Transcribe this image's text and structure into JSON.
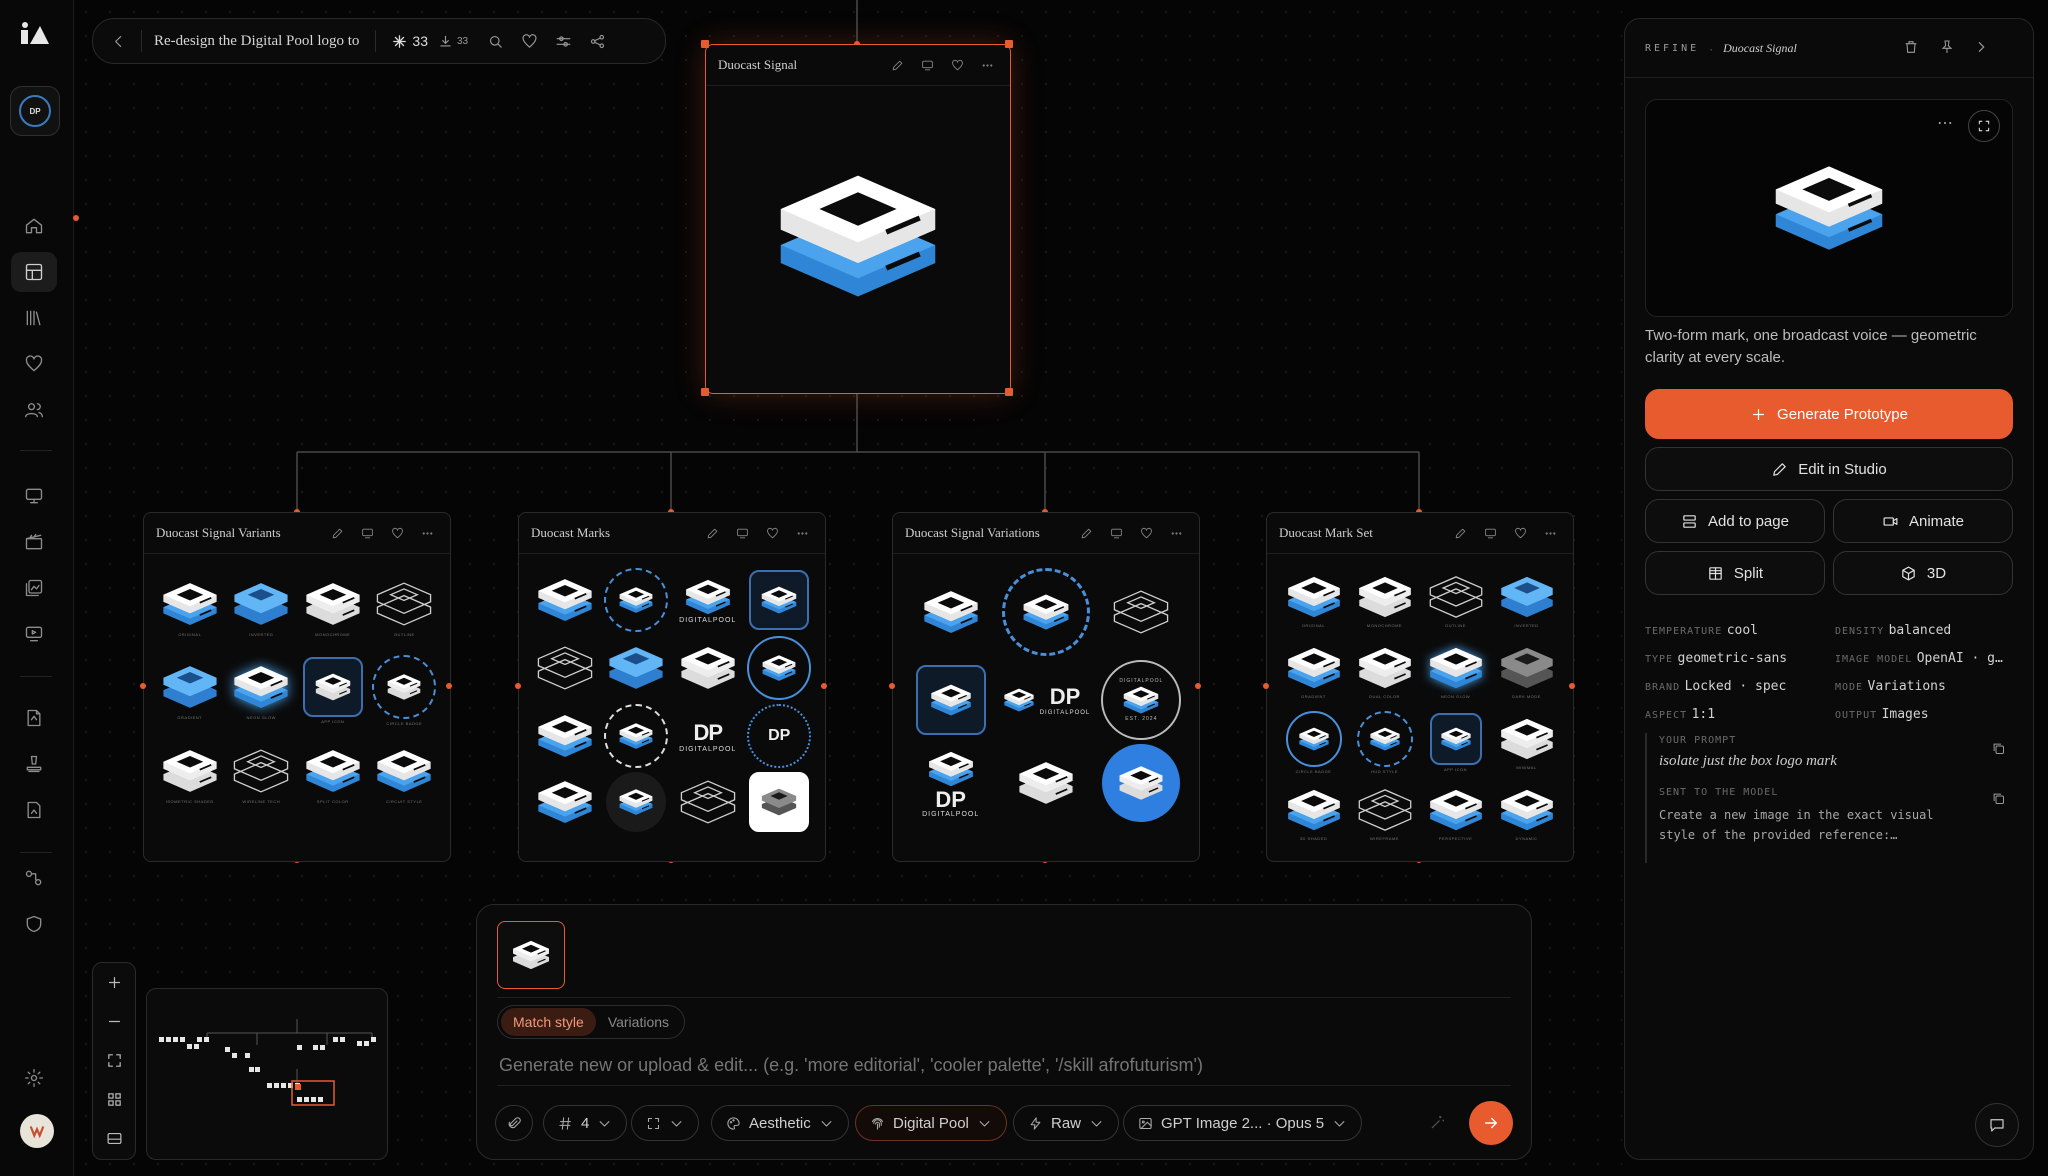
{
  "toolbar": {
    "title": "Re-design the Digital Pool logo to",
    "stars": "33",
    "downloads": "33"
  },
  "root_node": {
    "title": "Duocast Signal"
  },
  "children": [
    {
      "title": "Duocast Signal Variants",
      "labels": [
        "ORIGINAL",
        "INVERTED",
        "MONOCHROME",
        "OUTLINE",
        "GRADIENT",
        "NEON GLOW",
        "APP ICON",
        "CIRCLE BADGE",
        "ISOMETRIC SHADED",
        "WIRELINE TECH",
        "SPLIT COLOR",
        "CIRCUIT STYLE"
      ]
    },
    {
      "title": "Duocast Marks",
      "wordmark": "DIGITALPOOL",
      "mono": "DP"
    },
    {
      "title": "Duocast Signal Variations",
      "wordmark": "DIGITALPOOL",
      "mono": "DP",
      "badge_top": "DIGITALPOOL",
      "badge_bottom": "EST. 2024"
    },
    {
      "title": "Duocast Mark Set",
      "labels": [
        "ORIGINAL",
        "MONOCHROME",
        "OUTLINE",
        "INVERTED",
        "GRADIENT",
        "DUAL COLOR",
        "NEON GLOW",
        "DARK MODE",
        "CIRCLE BADGE",
        "HUD STYLE",
        "APP ICON",
        "MINIMAL",
        "3D SHADED",
        "WIREFRAME",
        "PERSPECTIVE",
        "DYNAMIC"
      ]
    }
  ],
  "composer": {
    "tabs": [
      "Match style",
      "Variations"
    ],
    "placeholder": "Generate new or upload & edit... (e.g. 'more editorial', 'cooler palette', '/skill afrofuturism')",
    "count_label": "4",
    "aesthetic": "Aesthetic",
    "brand": "Digital Pool",
    "mode": "Raw",
    "model": "GPT Image 2... · Opus 5"
  },
  "panel": {
    "header_label": "REFINE",
    "header_sep": "·",
    "header_title": "Duocast Signal",
    "description": "Two-form mark, one broadcast voice — geometric clarity at every scale.",
    "generate": "Generate Prototype",
    "edit": "Edit in Studio",
    "add_to_page": "Add to page",
    "animate": "Animate",
    "split": "Split",
    "three_d": "3D",
    "meta": [
      {
        "k": "TEMPERATURE",
        "v": "cool"
      },
      {
        "k": "DENSITY",
        "v": "balanced"
      },
      {
        "k": "TYPE",
        "v": "geometric-sans"
      },
      {
        "k": "IMAGE MODEL",
        "v": "OpenAI · g…"
      },
      {
        "k": "BRAND",
        "v": "Locked · spec"
      },
      {
        "k": "MODE",
        "v": "Variations"
      },
      {
        "k": "ASPECT",
        "v": "1:1"
      },
      {
        "k": "OUTPUT",
        "v": "Images"
      }
    ],
    "prompt_label": "YOUR PROMPT",
    "prompt_text": "isolate just the box logo mark",
    "sent_label": "SENT TO THE MODEL",
    "sent_text": "Create a new image in the exact visual style of the provided reference:…"
  },
  "colors": {
    "accent": "#e85b2e",
    "mark_blue": "#4aa3ec",
    "mark_white": "#ffffff"
  }
}
